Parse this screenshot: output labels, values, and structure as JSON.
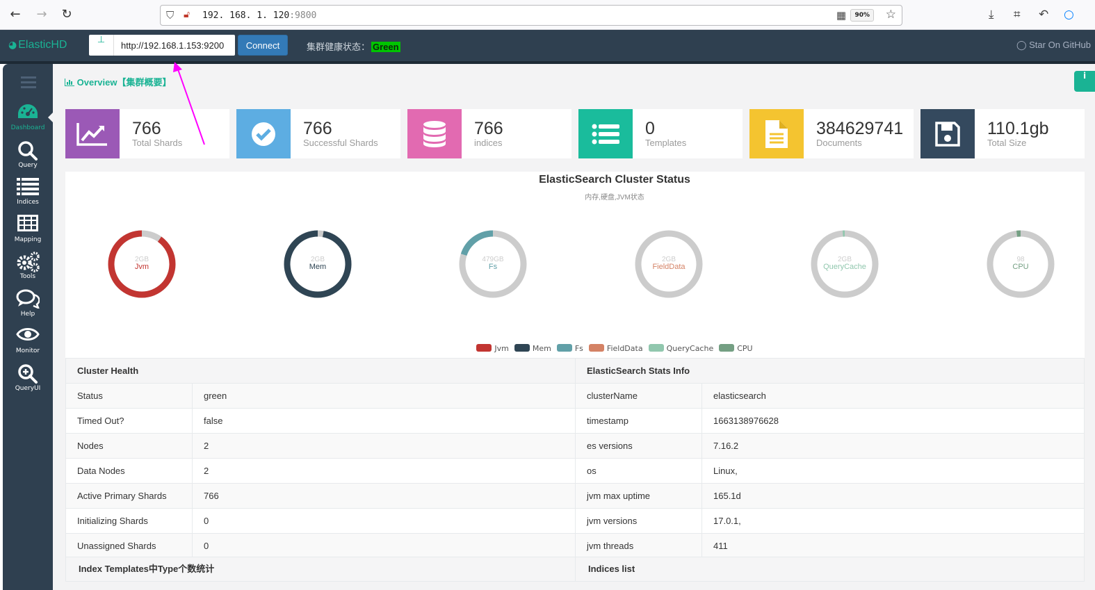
{
  "browser": {
    "url_host": "192. 168. 1. 120",
    "url_port": ":9800",
    "zoom": "90%"
  },
  "navbar": {
    "brand": "ElasticHD",
    "host_value": "http://192.168.1.153:9200",
    "connect_label": "Connect",
    "health_label": "集群健康状态：",
    "health_status": "Green",
    "github_label": "Star On GitHub"
  },
  "sidebar": {
    "items": [
      {
        "label": "Dashboard",
        "icon": "dashboard-icon"
      },
      {
        "label": "Query",
        "icon": "search-icon"
      },
      {
        "label": "Indices",
        "icon": "list-icon"
      },
      {
        "label": "Mapping",
        "icon": "table-icon"
      },
      {
        "label": "Tools",
        "icon": "cogs-icon"
      },
      {
        "label": "Help",
        "icon": "comments-icon"
      },
      {
        "label": "Monitor",
        "icon": "eye-icon"
      },
      {
        "label": "QueryUI",
        "icon": "zoom-in-icon"
      }
    ]
  },
  "overview": {
    "title": "Overview【集群概要】"
  },
  "stats": [
    {
      "value": "766",
      "caption": "Total Shards",
      "color": "#9b59b6",
      "icon": "line-chart-icon"
    },
    {
      "value": "766",
      "caption": "Successful Shards",
      "color": "#5dade2",
      "icon": "check-circle-icon"
    },
    {
      "value": "766",
      "caption": "indices",
      "color": "#e26ab1",
      "icon": "database-icon"
    },
    {
      "value": "0",
      "caption": "Templates",
      "color": "#1abc9c",
      "icon": "list-icon"
    },
    {
      "value": "384629741",
      "caption": "Documents",
      "color": "#f4c430",
      "icon": "file-icon"
    },
    {
      "value": "110.1gb",
      "caption": "Total Size",
      "color": "#34495e",
      "icon": "save-icon"
    }
  ],
  "chart_data": {
    "type": "pie",
    "title": "ElasticSearch Cluster Status",
    "subtitle": "内存,硬盘,JVM状态",
    "series": [
      {
        "name": "Jvm",
        "top": "2GB",
        "label": "Jvm",
        "fraction": 0.9,
        "color": "#c23531"
      },
      {
        "name": "Mem",
        "top": "2GB",
        "label": "Mem",
        "fraction": 0.97,
        "color": "#2f4554"
      },
      {
        "name": "Fs",
        "top": "479GB",
        "label": "Fs",
        "fraction": 0.2,
        "color": "#61a0a8"
      },
      {
        "name": "FieldData",
        "top": "2GB",
        "label": "FieldData",
        "fraction": 0.0,
        "color": "#d48265"
      },
      {
        "name": "QueryCache",
        "top": "2GB",
        "label": "QueryCache",
        "fraction": 0.01,
        "color": "#91c7ae"
      },
      {
        "name": "CPU",
        "top": "98",
        "label": "CPU",
        "fraction": 0.02,
        "color": "#749f83"
      }
    ],
    "track_color": "#cccccc",
    "legend_position": "bottom-center"
  },
  "cluster_health": {
    "title": "Cluster Health",
    "rows": [
      {
        "k": "Status",
        "v": "green"
      },
      {
        "k": "Timed Out?",
        "v": "false"
      },
      {
        "k": "Nodes",
        "v": "2"
      },
      {
        "k": "Data Nodes",
        "v": "2"
      },
      {
        "k": "Active Primary Shards",
        "v": "766"
      },
      {
        "k": "Initializing Shards",
        "v": "0"
      },
      {
        "k": "Unassigned Shards",
        "v": "0"
      }
    ]
  },
  "stats_info": {
    "title": "ElasticSearch Stats Info",
    "rows": [
      {
        "k": "clusterName",
        "v": "elasticsearch"
      },
      {
        "k": "timestamp",
        "v": "1663138976628"
      },
      {
        "k": "es versions",
        "v": "7.16.2"
      },
      {
        "k": "os",
        "v": "Linux,"
      },
      {
        "k": "jvm max uptime",
        "v": "165.1d"
      },
      {
        "k": "jvm versions",
        "v": "17.0.1,"
      },
      {
        "k": "jvm threads",
        "v": "411"
      }
    ]
  },
  "bottom": {
    "templates_title": "Index Templates中Type个数统计",
    "indices_title": "Indices list"
  }
}
